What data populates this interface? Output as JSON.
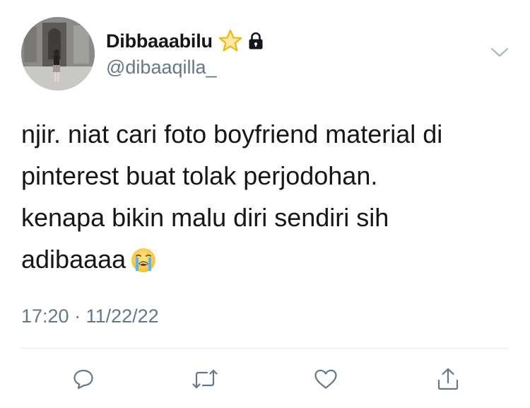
{
  "user": {
    "display_name": "Dibbaaabilu",
    "handle": "@dibaaqilla_",
    "name_emoji": "star-icon",
    "protected_icon": "lock-icon"
  },
  "tweet": {
    "lines": [
      "njir. niat cari foto boyfriend material di",
      "pinterest buat tolak perjodohan.",
      "kenapa bikin malu diri sendiri sih",
      "adibaaaa"
    ],
    "trailing_emoji": "loudly-crying-face-icon",
    "timestamp": "17:20 · 11/22/22"
  },
  "actions": [
    "reply-icon",
    "retweet-icon",
    "like-icon",
    "share-icon"
  ],
  "colors": {
    "text": "#14171a",
    "secondary": "#657786",
    "icon": "#657786",
    "divider": "#e1e8ed"
  }
}
